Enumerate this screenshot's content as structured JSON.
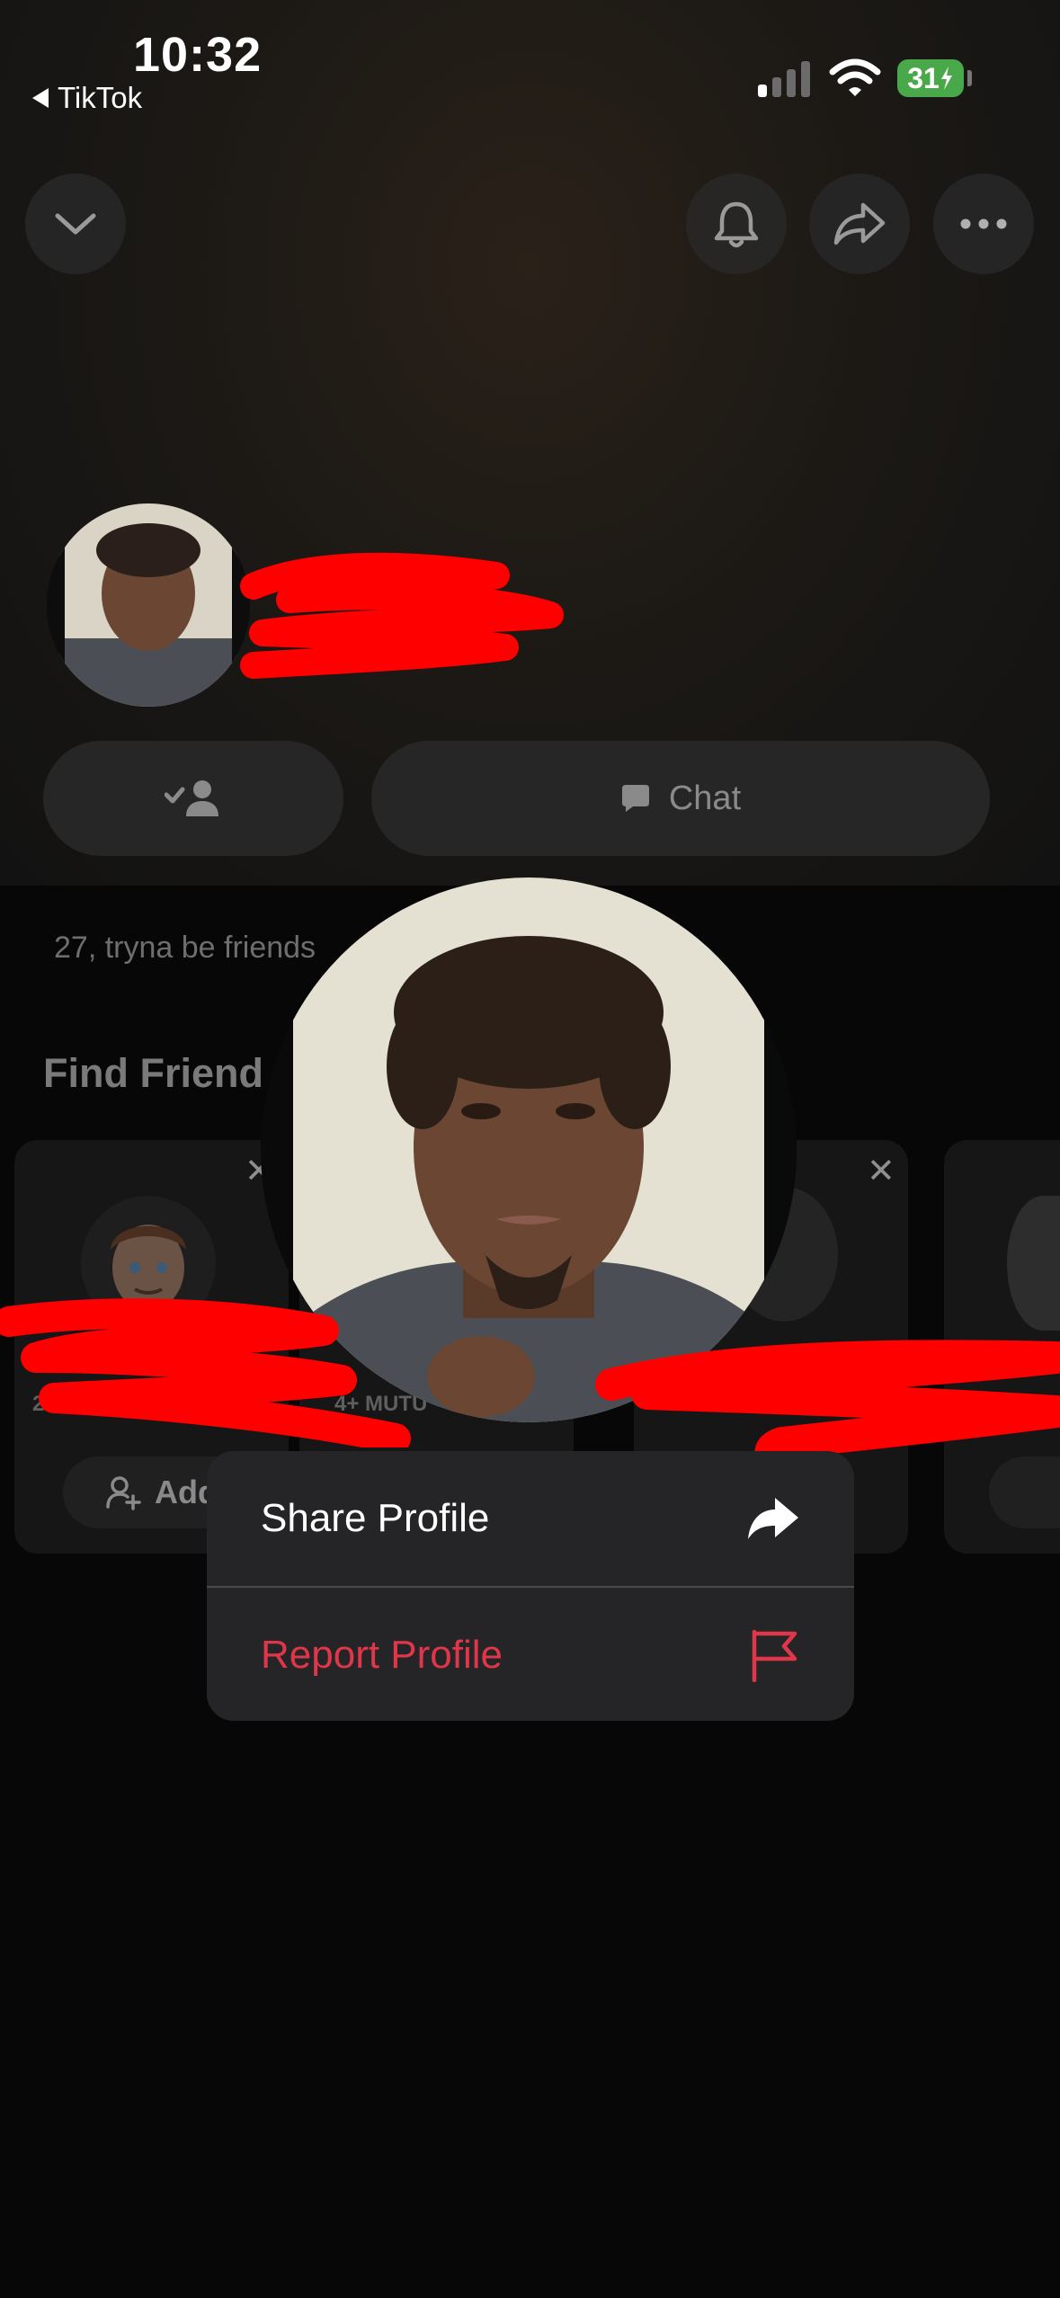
{
  "status_bar": {
    "time": "10:32",
    "back_app_label": "TikTok",
    "battery_level": "31"
  },
  "header": {
    "collapse_icon": "chevron-down-icon",
    "notification_icon": "bell-icon",
    "share_icon": "share-arrow-icon",
    "more_icon": "ellipsis-icon"
  },
  "profile": {
    "chat_button_label": "Chat",
    "friend_icon": "friend-added-icon",
    "bio": "27, tryna be friends"
  },
  "find_friends": {
    "title": "Find Friend",
    "cards": [
      {
        "mutuals": "2+ MUTU",
        "add_label": "Add"
      },
      {
        "mutuals": "4+ MUTU"
      }
    ]
  },
  "context_menu": {
    "items": [
      {
        "label": "Share Profile",
        "icon": "share-arrow-filled-icon",
        "color": "#ffffff"
      },
      {
        "label": "Report Profile",
        "icon": "flag-icon",
        "color": "#e0364a"
      }
    ]
  },
  "colors": {
    "accent_red": "#e0364a",
    "redaction": "#ff0000",
    "battery_green": "#49a84a"
  }
}
